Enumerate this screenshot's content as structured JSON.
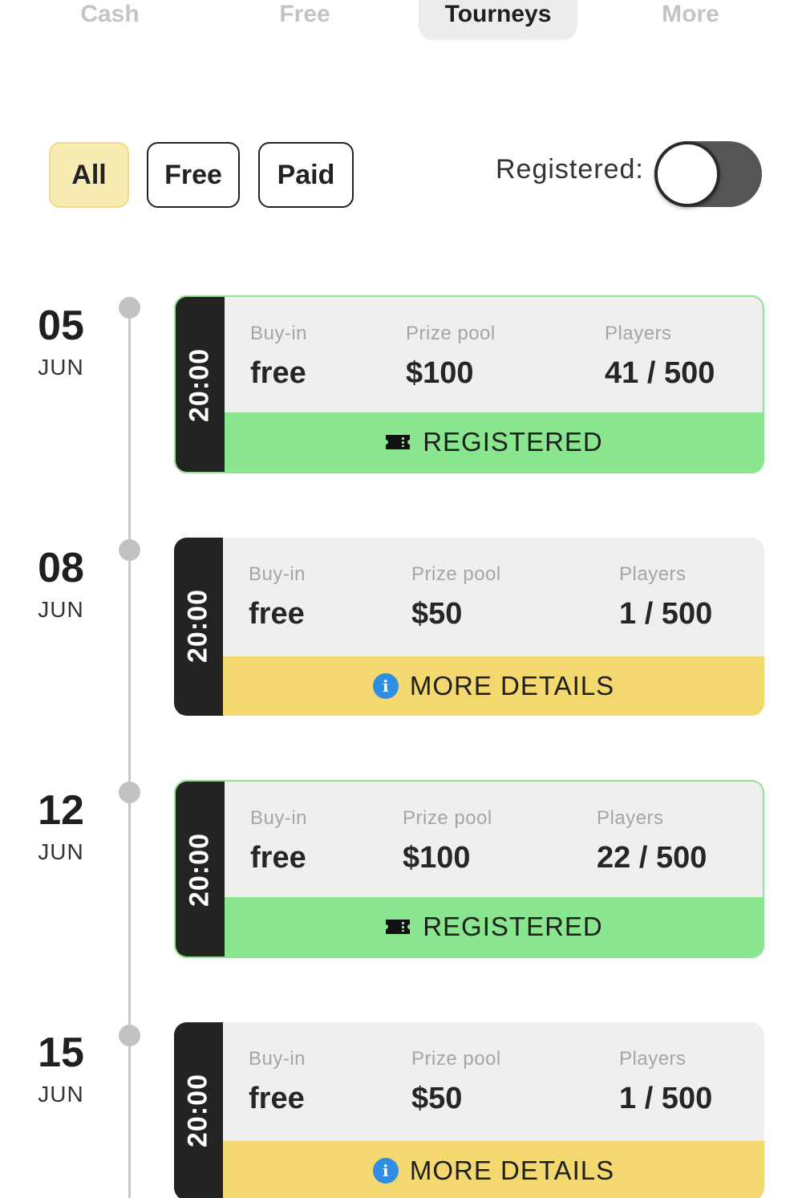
{
  "tabs": [
    {
      "label": "Cash"
    },
    {
      "label": "Free"
    },
    {
      "label": "Tourneys"
    },
    {
      "label": "More"
    }
  ],
  "filters": {
    "all": "All",
    "free": "Free",
    "paid": "Paid",
    "active": "All"
  },
  "registered_toggle": {
    "label": "Registered:",
    "on": false
  },
  "columns": {
    "buyin": "Buy-in",
    "prize": "Prize pool",
    "players": "Players"
  },
  "tournaments": [
    {
      "day": "05",
      "month": "JUN",
      "time": "20:00",
      "buyin": "free",
      "prize": "$100",
      "players": "41 / 500",
      "status": "registered",
      "action": "REGISTERED"
    },
    {
      "day": "08",
      "month": "JUN",
      "time": "20:00",
      "buyin": "free",
      "prize": "$50",
      "players": "1 / 500",
      "status": "details",
      "action": "MORE DETAILS"
    },
    {
      "day": "12",
      "month": "JUN",
      "time": "20:00",
      "buyin": "free",
      "prize": "$100",
      "players": "22 / 500",
      "status": "registered",
      "action": "REGISTERED"
    },
    {
      "day": "15",
      "month": "JUN",
      "time": "20:00",
      "buyin": "free",
      "prize": "$50",
      "players": "1 / 500",
      "status": "details",
      "action": "MORE DETAILS"
    }
  ],
  "icons": {
    "registered": "ticket-icon",
    "details": "info-icon"
  },
  "colors": {
    "registered_bg": "#8ae68e",
    "details_bg": "#f2d86e",
    "filter_active_bg": "#f8ecb2",
    "time_strip": "#232323",
    "info_blue": "#2f8de4"
  }
}
